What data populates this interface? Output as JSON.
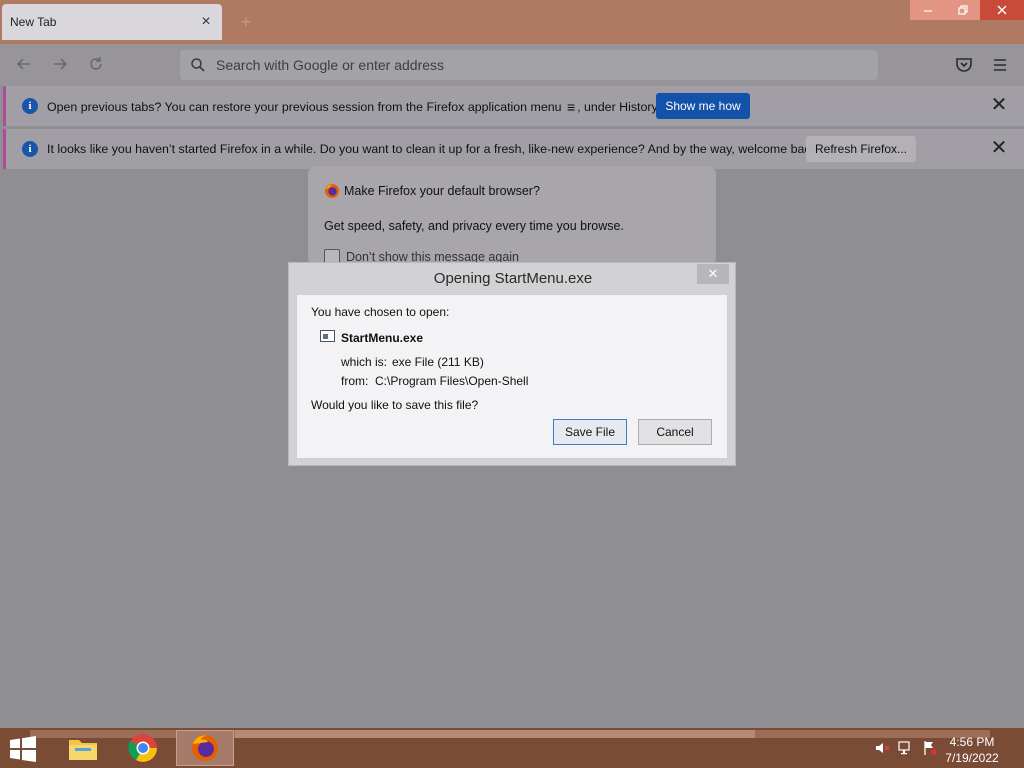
{
  "window": {
    "tab_title": "New Tab",
    "new_tab_symbol": "+",
    "controls": {
      "minimize": "–",
      "maximize": "❐",
      "close": "✕"
    }
  },
  "navbar": {
    "back_icon": "back-arrow-icon",
    "forward_icon": "forward-arrow-icon",
    "reload_icon": "reload-icon",
    "search_placeholder": "Search with Google or enter address",
    "pocket_icon": "pocket-icon",
    "menu_icon": "hamburger-menu-icon"
  },
  "notifications": [
    {
      "message_before": "Open previous tabs? You can restore your previous session from the Firefox application menu",
      "menu_glyph": "≡",
      "message_after": ", under History.",
      "button": "Show me how"
    },
    {
      "message": "It looks like you haven’t started Firefox in a while. Do you want to clean it up for a fresh, like-new experience? And by the way, welcome back!",
      "button": "Refresh Firefox..."
    }
  ],
  "default_browser_card": {
    "title": "Make Firefox your default browser?",
    "body": "Get speed, safety, and privacy every time you browse.",
    "checkbox_label": "Don’t show this message again"
  },
  "download_dialog": {
    "title": "Opening StartMenu.exe",
    "close_symbol": "✕",
    "intro": "You have chosen to open:",
    "file_name": "StartMenu.exe",
    "which_is_label": "which is:",
    "which_is_value": "exe File (211 KB)",
    "from_label": "from:",
    "from_value": "C:\\Program Files\\Open-Shell",
    "question": "Would you like to save this file?",
    "save_button": "Save File",
    "cancel_button": "Cancel"
  },
  "taskbar": {
    "apps": [
      "file-explorer",
      "chrome",
      "firefox"
    ],
    "time": "4:56 PM",
    "date": "7/19/2022"
  },
  "colors": {
    "titlebar": "#b07a62",
    "accent_blue": "#1252a8",
    "taskbar": "#7a4b35"
  }
}
